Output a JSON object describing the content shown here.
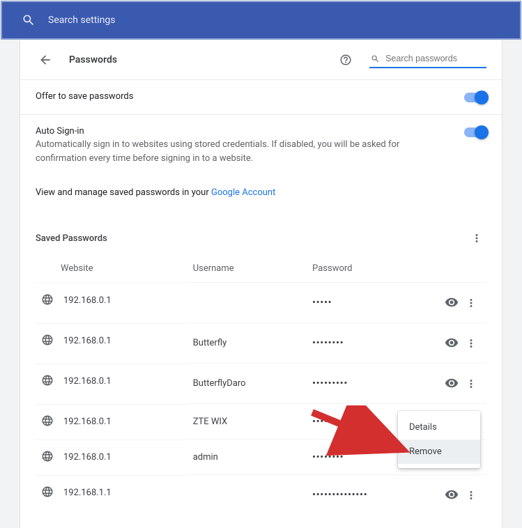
{
  "searchbar": {
    "placeholder": "Search settings"
  },
  "header": {
    "title": "Passwords",
    "search_placeholder": "Search passwords"
  },
  "offer": {
    "label": "Offer to save passwords"
  },
  "autosignin": {
    "title": "Auto Sign-in",
    "desc": "Automatically sign in to websites using stored credentials. If disabled, you will be asked for confirmation every time before signing in to a website."
  },
  "view_manage": {
    "prefix": "View and manage saved passwords in your ",
    "link_label": "Google Account"
  },
  "saved": {
    "heading": "Saved Passwords",
    "cols": {
      "website": "Website",
      "username": "Username",
      "password": "Password"
    },
    "rows": [
      {
        "site": "192.168.0.1",
        "user": "",
        "mask": "•••••"
      },
      {
        "site": "192.168.0.1",
        "user": "Butterfly",
        "mask": "••••••••"
      },
      {
        "site": "192.168.0.1",
        "user": "ButterflyDaro",
        "mask": "•••••••••"
      },
      {
        "site": "192.168.0.1",
        "user": "ZTE WIX",
        "mask": "•••••••••••"
      },
      {
        "site": "192.168.0.1",
        "user": "admin",
        "mask": "••••••••"
      },
      {
        "site": "192.168.1.1",
        "user": "",
        "mask": "••••••••••••••"
      }
    ]
  },
  "menu": {
    "details": "Details",
    "remove": "Remove"
  }
}
